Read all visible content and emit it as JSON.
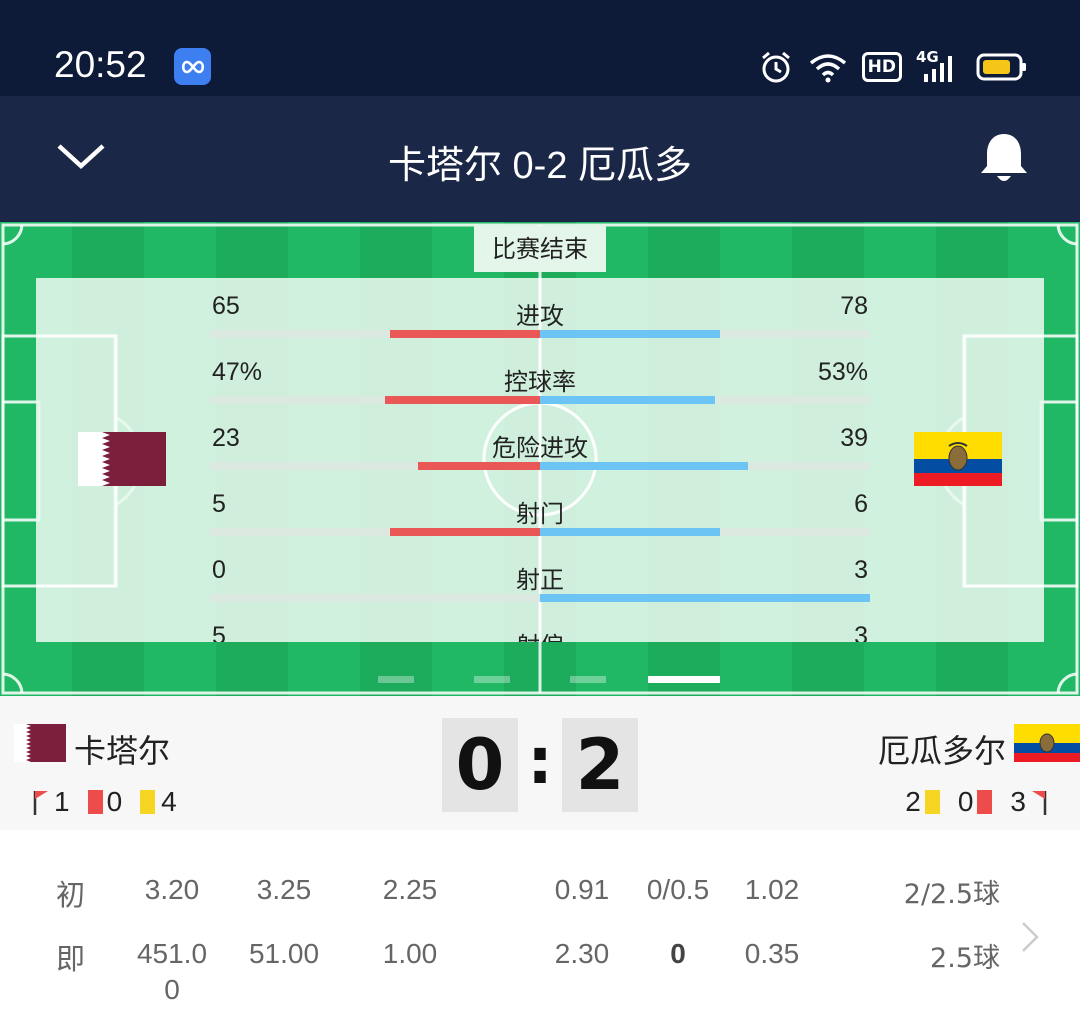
{
  "status_bar": {
    "time": "20:52",
    "hd_label": "HD",
    "network_label": "4G"
  },
  "header": {
    "title": "卡塔尔 0-2 厄瓜多"
  },
  "match_status": "比赛结束",
  "stats": [
    {
      "label": "进攻",
      "home": "65",
      "away": "78",
      "home_value": 65,
      "away_value": 78
    },
    {
      "label": "控球率",
      "home": "47%",
      "away": "53%",
      "home_value": 47,
      "away_value": 53
    },
    {
      "label": "危险进攻",
      "home": "23",
      "away": "39",
      "home_value": 23,
      "away_value": 39
    },
    {
      "label": "射门",
      "home": "5",
      "away": "6",
      "home_value": 5,
      "away_value": 6
    },
    {
      "label": "射正",
      "home": "0",
      "away": "3",
      "home_value": 0,
      "away_value": 3
    },
    {
      "label": "射偏",
      "home": "5",
      "away": "3",
      "home_value": 5,
      "away_value": 3
    }
  ],
  "pager": {
    "count": 4,
    "active": 3
  },
  "home_team": {
    "name": "卡塔尔",
    "score": "0",
    "corners": "1",
    "red_cards": "0",
    "yellow_cards": "4"
  },
  "away_team": {
    "name": "厄瓜多尔",
    "score": "2",
    "corners": "3",
    "red_cards": "0",
    "yellow_cards": "2"
  },
  "score_separator": ":",
  "odds": {
    "initial": {
      "label": "初",
      "euro": [
        "3.20",
        "3.25",
        "2.25"
      ],
      "asian": [
        "0.91",
        "0/0.5",
        "1.02"
      ],
      "total": "2/2.5球"
    },
    "live": {
      "label": "即",
      "euro": [
        "451.0",
        "51.00",
        "1.00"
      ],
      "euro_wrap": "0",
      "asian": [
        "2.30",
        "0",
        "0.35"
      ],
      "total": "2.5球"
    }
  },
  "colors": {
    "home_bar": "#ea5757",
    "away_bar": "#6cc4f4",
    "pitch": "#1dab5c",
    "header": "#1b2747",
    "status_bar": "#0d1a38"
  }
}
